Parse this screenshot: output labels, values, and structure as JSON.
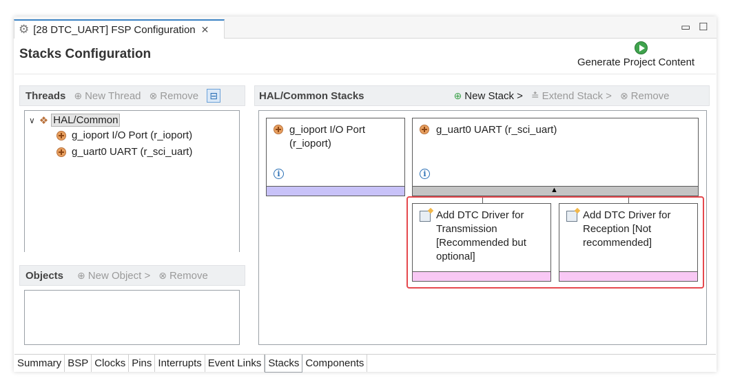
{
  "editor": {
    "tab_title": "[28 DTC_UART] FSP Configuration",
    "close_glyph": "✕",
    "minimize_glyph": "▭",
    "maximize_glyph": "☐"
  },
  "header": {
    "title": "Stacks Configuration",
    "generate_label": "Generate Project Content"
  },
  "threads": {
    "heading": "Threads",
    "new_thread": "New Thread",
    "remove": "Remove",
    "tree": {
      "root": "HAL/Common",
      "children": [
        "g_ioport I/O Port (r_ioport)",
        "g_uart0 UART (r_sci_uart)"
      ]
    }
  },
  "objects": {
    "heading": "Objects",
    "new_object": "New Object >",
    "remove": "Remove"
  },
  "stacks": {
    "heading": "HAL/Common Stacks",
    "new_stack": "New Stack >",
    "extend_stack": "Extend Stack >",
    "remove": "Remove",
    "blocks": [
      {
        "line1": "g_ioport I/O Port",
        "line2": "(r_ioport)"
      },
      {
        "line1": "g_uart0 UART (r_sci_uart)"
      }
    ],
    "dtc_blocks": [
      {
        "lines": [
          "Add DTC Driver for",
          "Transmission",
          "[Recommended but",
          "optional]"
        ]
      },
      {
        "lines": [
          "Add DTC Driver for",
          "Reception [Not",
          "recommended]"
        ]
      }
    ]
  },
  "bottom_tabs": [
    "Summary",
    "BSP",
    "Clocks",
    "Pins",
    "Interrupts",
    "Event Links",
    "Stacks",
    "Components"
  ],
  "active_tab": "Stacks",
  "colors": {
    "accent": "#3b82c4",
    "highlight": "#e5484d",
    "lavender_bar": "#c8c2f8",
    "pink_bar": "#f8c8f4"
  }
}
